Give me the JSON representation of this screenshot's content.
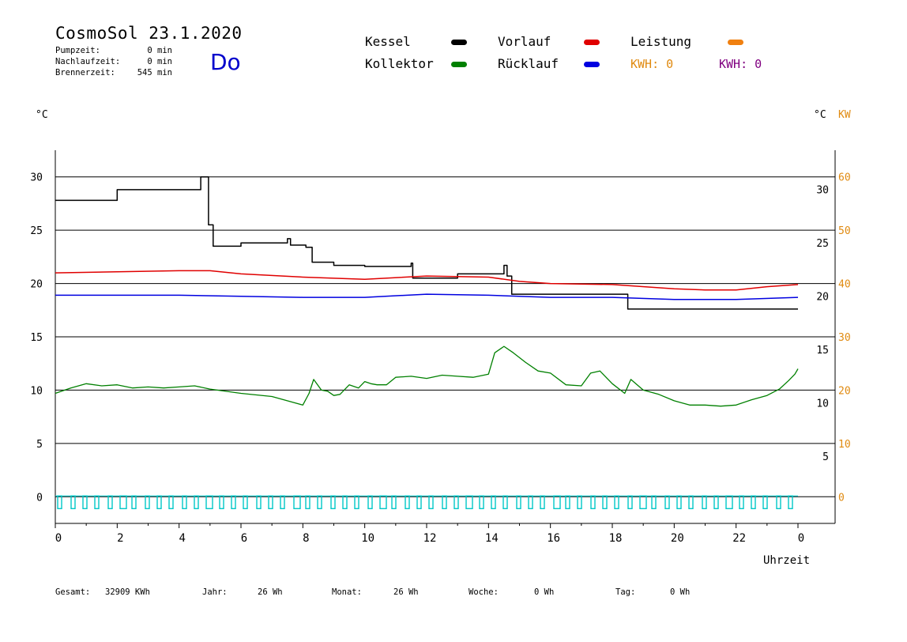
{
  "header": {
    "title": "CosmoSol 23.1.2020",
    "day": "Do",
    "stats": [
      {
        "label": "Pumpzeit:",
        "value": "0 min"
      },
      {
        "label": "Nachlaufzeit:",
        "value": "0 min"
      },
      {
        "label": "Brennerzeit:",
        "value": "545 min"
      }
    ]
  },
  "legend": {
    "items": [
      {
        "label": "Kessel",
        "color": "#000000"
      },
      {
        "label": "Vorlauf",
        "color": "#e00000"
      },
      {
        "label": "Leistung",
        "color": "#f08010"
      },
      {
        "label": "Kollektor",
        "color": "#008000"
      },
      {
        "label": "Rücklauf",
        "color": "#0000e0"
      }
    ],
    "kwh1": "KWH: 0",
    "kwh1_color": "#e08a10",
    "kwh2": "KWH: 0",
    "kwh2_color": "#800080"
  },
  "axis_units": {
    "left": "°C",
    "right_c": "°C",
    "right_kw": "KW",
    "x": "Uhrzeit"
  },
  "footer": {
    "items": [
      {
        "label": "Gesamt:",
        "value": "32909 KWh"
      },
      {
        "label": "Jahr:",
        "value": "26 Wh"
      },
      {
        "label": "Monat:",
        "value": "26 Wh"
      },
      {
        "label": "Woche:",
        "value": "0 Wh"
      },
      {
        "label": "Tag:",
        "value": "0 Wh"
      }
    ]
  },
  "chart_data": {
    "type": "line",
    "xlabel": "Uhrzeit",
    "xlim": [
      0,
      24
    ],
    "x_ticks": [
      "0",
      "2",
      "4",
      "6",
      "8",
      "10",
      "12",
      "14",
      "16",
      "18",
      "20",
      "22",
      "0"
    ],
    "ylim": [
      -2.5,
      32.5
    ],
    "y_ticks_left": [
      "0",
      "5",
      "10",
      "15",
      "20",
      "25",
      "30"
    ],
    "y_ticks_right_c": [
      "5",
      "10",
      "15",
      "20",
      "25",
      "30"
    ],
    "y_ticks_right_kw": [
      "0",
      "10",
      "20",
      "30",
      "40",
      "50",
      "60"
    ],
    "grid": true,
    "legend_position": "top",
    "series": [
      {
        "name": "Kessel",
        "color": "#000000",
        "x": [
          0,
          2,
          4.7,
          4.8,
          4.95,
          5.1,
          6,
          7.5,
          7.6,
          8.1,
          8.3,
          9,
          10,
          11.5,
          11.55,
          12,
          13,
          14.5,
          14.6,
          14.75,
          15,
          16,
          17,
          18.3,
          18.5,
          18.6,
          18.8,
          20,
          22,
          24
        ],
        "y": [
          27.8,
          28.8,
          30.0,
          30.0,
          25.5,
          23.5,
          23.8,
          24.2,
          23.6,
          23.4,
          22.0,
          21.7,
          21.6,
          21.9,
          20.5,
          20.5,
          20.9,
          21.7,
          20.7,
          19.0,
          19.0,
          19.0,
          19.0,
          19.0,
          17.6,
          17.6,
          17.6,
          17.6,
          17.6,
          17.6
        ]
      },
      {
        "name": "Vorlauf",
        "color": "#e00000",
        "x": [
          0,
          2,
          4,
          5,
          6,
          8,
          10,
          12,
          14,
          15,
          16,
          18,
          20,
          21,
          22,
          23,
          24
        ],
        "y": [
          21.0,
          21.1,
          21.2,
          21.2,
          20.9,
          20.6,
          20.4,
          20.7,
          20.6,
          20.2,
          20.0,
          19.9,
          19.5,
          19.4,
          19.4,
          19.7,
          19.9
        ]
      },
      {
        "name": "Rücklauf",
        "color": "#0000e0",
        "x": [
          0,
          2,
          4,
          6,
          8,
          10,
          12,
          14,
          16,
          18,
          20,
          22,
          24
        ],
        "y": [
          18.9,
          18.9,
          18.9,
          18.8,
          18.7,
          18.7,
          19.0,
          18.9,
          18.7,
          18.7,
          18.5,
          18.5,
          18.7
        ]
      },
      {
        "name": "Kollektor",
        "color": "#008000",
        "x": [
          0,
          0.5,
          1,
          1.5,
          2,
          2.5,
          3,
          3.5,
          4,
          4.5,
          5,
          6,
          7,
          8,
          8.2,
          8.35,
          8.6,
          8.8,
          9,
          9.2,
          9.5,
          9.8,
          10,
          10.2,
          10.4,
          10.7,
          11,
          11.5,
          12,
          12.5,
          13,
          13.5,
          14,
          14.2,
          14.5,
          14.8,
          15.2,
          15.6,
          16,
          16.5,
          17,
          17.3,
          17.6,
          18,
          18.4,
          18.6,
          19,
          19.5,
          20,
          20.5,
          21,
          21.5,
          22,
          22.5,
          23,
          23.4,
          23.7,
          23.9,
          24
        ],
        "y": [
          9.7,
          10.2,
          10.6,
          10.4,
          10.5,
          10.2,
          10.3,
          10.2,
          10.3,
          10.4,
          10.1,
          9.7,
          9.4,
          8.6,
          9.7,
          11.0,
          10.0,
          9.9,
          9.5,
          9.6,
          10.5,
          10.2,
          10.8,
          10.6,
          10.5,
          10.5,
          11.2,
          11.3,
          11.1,
          11.4,
          11.3,
          11.2,
          11.5,
          13.5,
          14.1,
          13.5,
          12.6,
          11.8,
          11.6,
          10.5,
          10.4,
          11.6,
          11.8,
          10.6,
          9.7,
          11.0,
          10.0,
          9.6,
          9.0,
          8.6,
          8.6,
          8.5,
          8.6,
          9.1,
          9.5,
          10.1,
          10.9,
          11.5,
          12.0
        ]
      },
      {
        "name": "Leistung",
        "color": "#f08010",
        "x": [
          0,
          24
        ],
        "y": [
          0,
          0
        ]
      }
    ]
  }
}
